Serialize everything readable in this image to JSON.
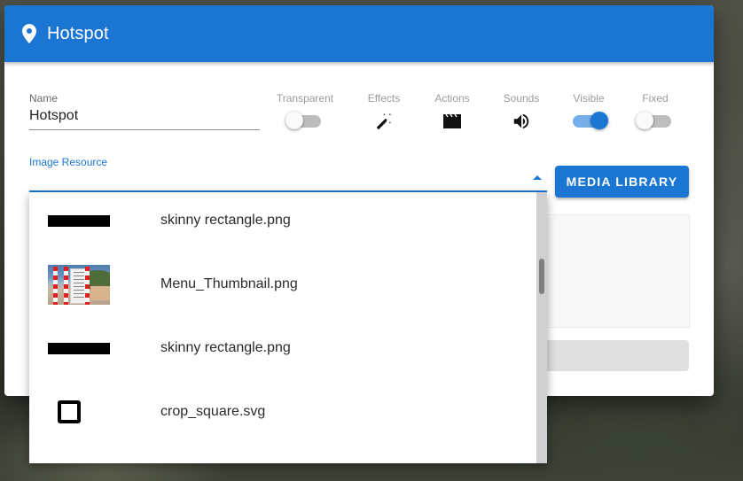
{
  "dialog": {
    "title": "Hotspot",
    "title_icon": "map-marker-icon",
    "accent_color": "#1a76d2"
  },
  "name_field": {
    "label": "Name",
    "value": "Hotspot"
  },
  "options": [
    {
      "label": "Transparent",
      "type": "switch",
      "on": false
    },
    {
      "label": "Effects",
      "type": "icon",
      "icon": "magic-wand-icon"
    },
    {
      "label": "Actions",
      "type": "icon",
      "icon": "clapperboard-icon"
    },
    {
      "label": "Sounds",
      "type": "icon",
      "icon": "volume-icon"
    },
    {
      "label": "Visible",
      "type": "switch",
      "on": true
    },
    {
      "label": "Fixed",
      "type": "switch",
      "on": false
    }
  ],
  "image_resource": {
    "label": "Image Resource",
    "value": "",
    "open": true
  },
  "media_library_button": "MEDIA LIBRARY",
  "dropdown_items": [
    {
      "name": "skinny rectangle.png",
      "thumb": "skinny-rectangle"
    },
    {
      "name": "Menu_Thumbnail.png",
      "thumb": "menu-thumbnail"
    },
    {
      "name": "skinny rectangle.png",
      "thumb": "skinny-rectangle"
    },
    {
      "name": "crop_square.svg",
      "thumb": "crop-square"
    }
  ]
}
